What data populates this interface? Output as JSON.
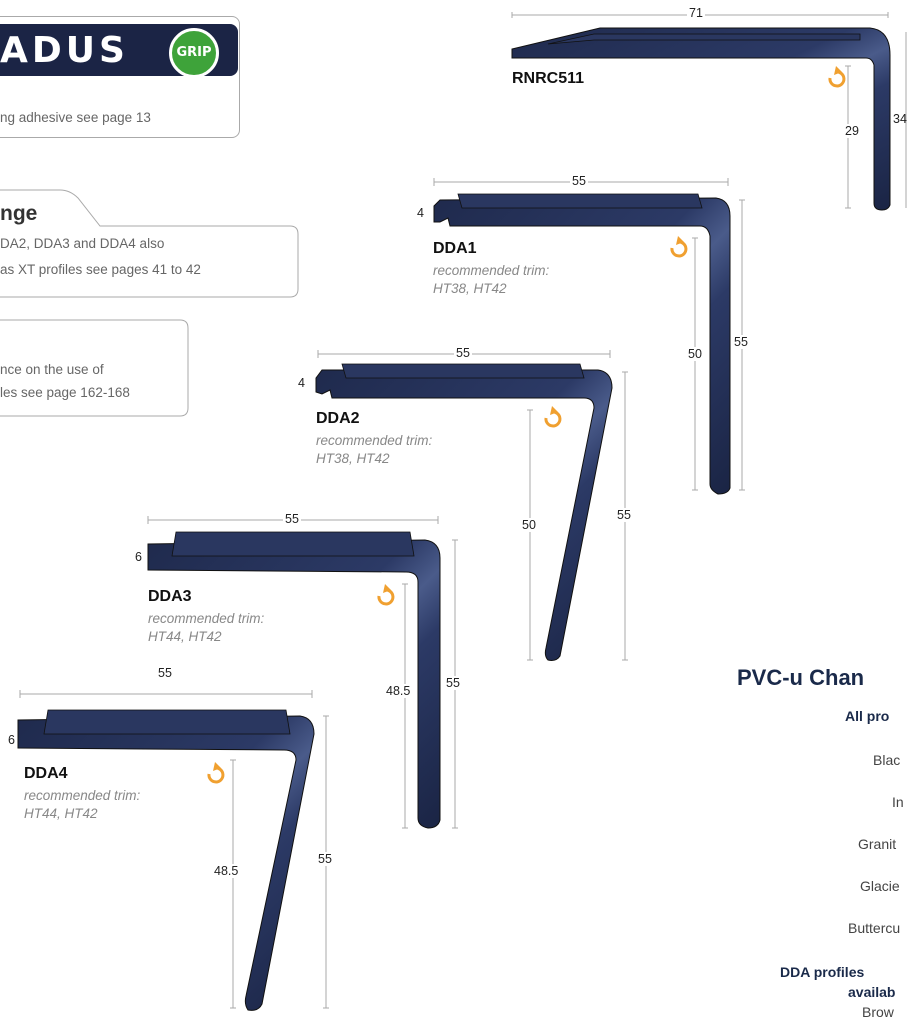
{
  "colors": {
    "profile": "#1f2a4d",
    "profile_highlight": "#4a5b8a",
    "grip_green": "#3ea33a",
    "logo_navy": "#1b2445",
    "arrow_orange": "#f0a030"
  },
  "logo": {
    "word": "ADUS",
    "badge": "GRIP"
  },
  "adhesive_note": "ng adhesive see page 13",
  "range": {
    "title": "nge",
    "line1": "DA2, DDA3 and DDA4 also",
    "line2": "as XT profiles see pages 41 to 42"
  },
  "guidance": {
    "line1": "nce on the use of",
    "line2": "les see page 162-168"
  },
  "icons": {
    "recycle": "recycle-arrow-icon"
  },
  "profiles": {
    "rnrc511": {
      "name": "RNRC511",
      "width": "71",
      "depth_inner": "29",
      "depth_outer": "34"
    },
    "dda1": {
      "name": "DDA1",
      "trim_label": "recommended trim:",
      "trim": "HT38, HT42",
      "width": "55",
      "thickness": "4",
      "depth_inner": "50",
      "depth_outer": "55"
    },
    "dda2": {
      "name": "DDA2",
      "trim_label": "recommended trim:",
      "trim": "HT38, HT42",
      "width": "55",
      "thickness": "4",
      "depth_inner": "50",
      "depth_outer": "55"
    },
    "dda3": {
      "name": "DDA3",
      "trim_label": "recommended trim:",
      "trim": "HT44, HT42",
      "width": "55",
      "thickness": "6",
      "depth_inner": "48.5",
      "depth_outer": "55"
    },
    "dda4": {
      "name": "DDA4",
      "trim_label": "recommended trim:",
      "trim": "HT44, HT42",
      "width": "55",
      "thickness": "6",
      "depth_inner": "48.5",
      "depth_outer": "55"
    }
  },
  "pvc": {
    "title": "PVC-u Chan",
    "all_profiles": "All pro",
    "colours": [
      "Blac",
      "In",
      "Granit",
      "Glacie",
      "Buttercu"
    ],
    "dda_line1": "DDA profiles",
    "dda_line2": "availab",
    "last_colour": "Brow"
  }
}
